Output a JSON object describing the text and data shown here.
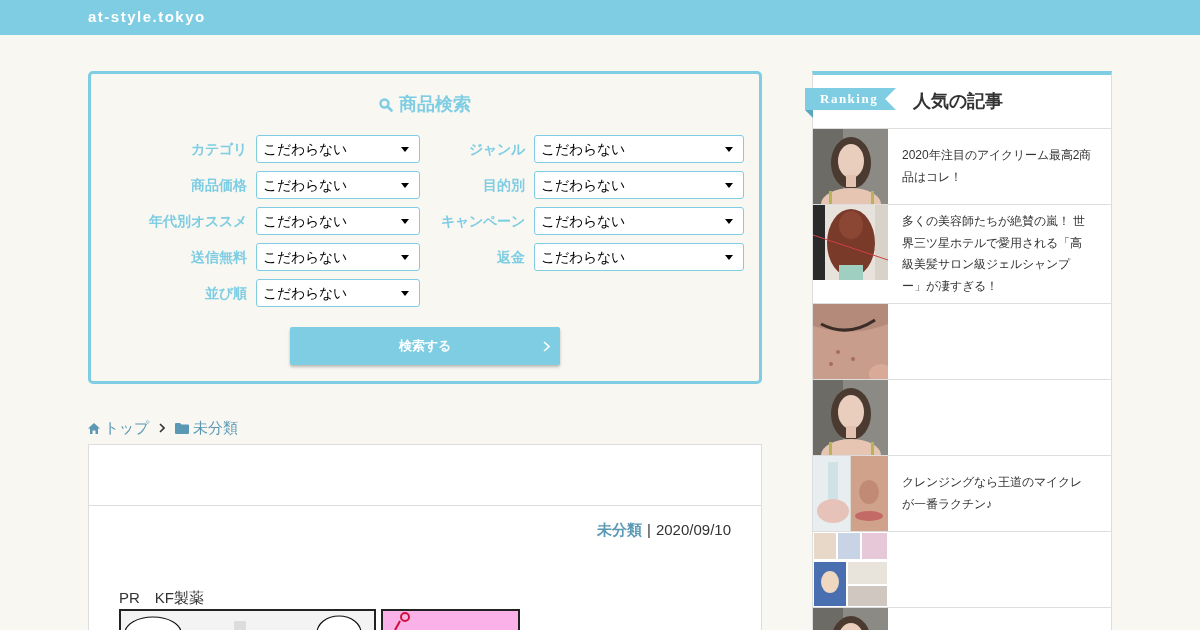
{
  "header": {
    "site_title": "at-style.tokyo"
  },
  "search": {
    "title": "商品検索",
    "fields": [
      {
        "label": "カテゴリ",
        "value": "こだわらない"
      },
      {
        "label": "ジャンル",
        "value": "こだわらない"
      },
      {
        "label": "商品価格",
        "value": "こだわらない"
      },
      {
        "label": "目的別",
        "value": "こだわらない"
      },
      {
        "label": "年代別オススメ",
        "value": "こだわらない"
      },
      {
        "label": "キャンペーン",
        "value": "こだわらない"
      },
      {
        "label": "送信無料",
        "value": "こだわらない"
      },
      {
        "label": "返金",
        "value": "こだわらない"
      },
      {
        "label": "並び順",
        "value": "こだわらない"
      }
    ],
    "button": "検索する"
  },
  "breadcrumb": [
    {
      "kind": "home",
      "label": "トップ"
    },
    {
      "kind": "folder",
      "label": "未分類"
    }
  ],
  "article": {
    "category": "未分類",
    "separator": "|",
    "date": "2020/09/10",
    "lead": "PR　KF製薬",
    "images": [
      {
        "kind": "picture"
      },
      {
        "kind": "picture"
      }
    ]
  },
  "sidebar": {
    "badge": "Ranking",
    "title": "人気の記事",
    "items": [
      {
        "kind": "picture",
        "title": "2020年注目のアイクリーム最高2商品はコレ！"
      },
      {
        "kind": "picture",
        "title": "多くの美容師たちが絶賛の嵐！ 世界三ツ星ホテルで愛用される「高級美髪サロン級ジェルシャンプー」が凄すぎる！"
      },
      {
        "kind": "picture"
      },
      {
        "kind": "picture"
      },
      {
        "kind": "picture",
        "title": "クレンジングなら王道のマイクレが一番ラクチン♪"
      },
      {
        "kind": "picture"
      },
      {
        "kind": "picture"
      }
    ]
  }
}
